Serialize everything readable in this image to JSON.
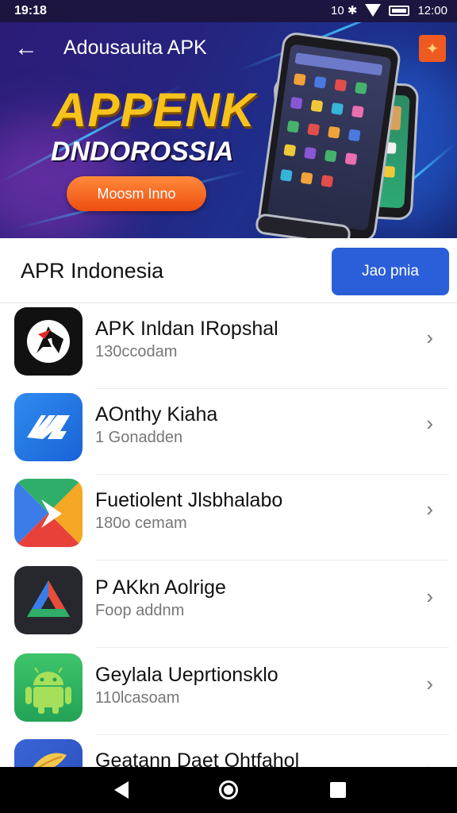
{
  "status_bar": {
    "time": "19:18",
    "right_glyphs": "10 ✱",
    "clock": "12:00"
  },
  "header": {
    "title": "Adousauita APK",
    "back_icon": "arrow-left-icon",
    "share_icon": "share-icon"
  },
  "banner": {
    "title": "APPENK",
    "subtitle": "DNDOROSSIA",
    "cta": "Moosm Inno"
  },
  "section": {
    "title": "APR Indonesia",
    "button": "Jao pnia"
  },
  "apps": [
    {
      "name": "APK Inldan IRopshal",
      "meta": "130ccodam",
      "icon": "ax-logo-icon"
    },
    {
      "name": "AOnthy Kiaha",
      "meta": "1 Gonadden",
      "icon": "n-logo-icon"
    },
    {
      "name": "Fuetiolent Jlsbhalabo",
      "meta": "180o cemam",
      "icon": "play-arrow-icon"
    },
    {
      "name": "P AKkn Aolrige",
      "meta": "Foop addnm",
      "icon": "triangle-logo-icon"
    },
    {
      "name": "Geylala Ueprtionsklo",
      "meta": "110lcasoam",
      "icon": "android-icon"
    },
    {
      "name": "Geatann Daet Ohtfahol",
      "meta": "",
      "icon": "leaf-icon"
    }
  ],
  "colors": {
    "accent": "#2b5fd9",
    "banner_gold": "#f7c21b",
    "cta_orange": "#ee4d10",
    "status_bg": "#1b1540"
  },
  "navbar": {
    "back_icon": "nav-back-icon",
    "home_icon": "nav-home-icon",
    "recents_icon": "nav-recents-icon"
  }
}
